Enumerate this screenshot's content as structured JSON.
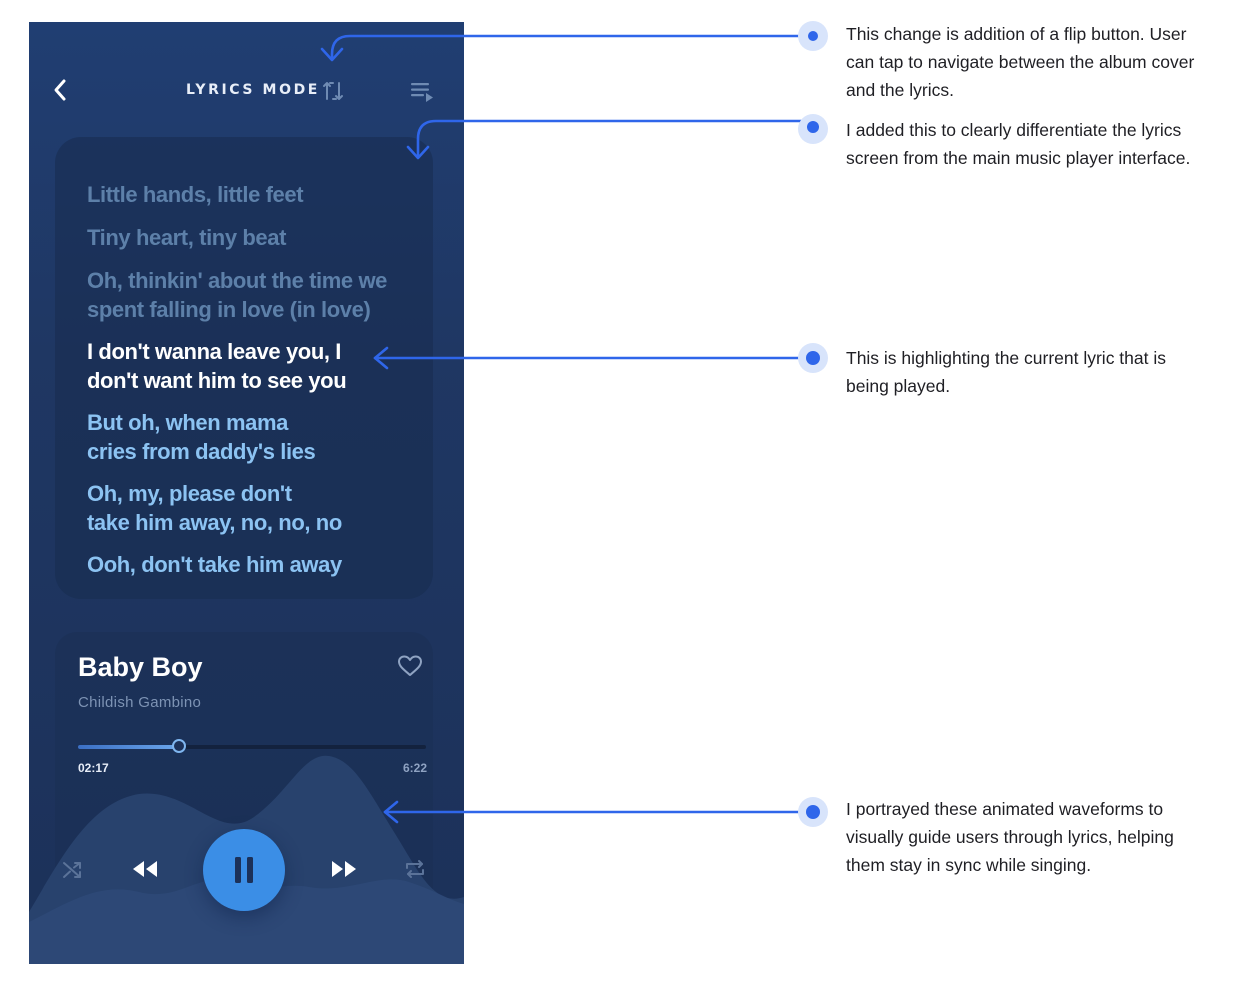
{
  "screen": {
    "header": {
      "back_icon": "chevron-left-icon",
      "title": "LYRICS MODE",
      "flip_icon": "flip-icon",
      "queue_icon": "queue-icon"
    },
    "lyrics": [
      {
        "text": "Little hands, little feet",
        "state": "past"
      },
      {
        "text": "Tiny heart, tiny beat",
        "state": "past"
      },
      {
        "text": "Oh, thinkin' about the time we\nspent falling in love (in love)",
        "state": "past"
      },
      {
        "text": "I don't wanna leave you, I\ndon't want him to see you",
        "state": "current"
      },
      {
        "text": "But oh, when mama\ncries from daddy's lies",
        "state": "upcoming"
      },
      {
        "text": "Oh, my, please don't\ntake him away, no, no, no",
        "state": "upcoming"
      },
      {
        "text": "Ooh, don't take him away",
        "state": "upcoming"
      }
    ],
    "now_playing": {
      "title": "Baby Boy",
      "artist": "Childish Gambino",
      "favorite_icon": "heart-icon",
      "elapsed": "02:17",
      "duration": "6:22",
      "progress_fraction": 0.29
    },
    "controls": {
      "shuffle_icon": "shuffle-icon",
      "previous_icon": "rewind-icon",
      "play_state_icon": "pause-icon",
      "next_icon": "fast-forward-icon",
      "repeat_icon": "repeat-icon"
    },
    "colors": {
      "background": "#1f3763",
      "accent": "#3b8ee6",
      "current_lyric": "#ffffff",
      "upcoming_lyric": "#8cc3f2",
      "past_lyric": "#5d80a9"
    }
  },
  "annotations": [
    {
      "text": "This change is addition of a flip button. User can tap to navigate between the album cover and the lyrics."
    },
    {
      "text": "I added this to clearly differentiate the lyrics screen from the main music player interface."
    },
    {
      "text": "This is highlighting the current lyric that is being played."
    },
    {
      "text": "I portrayed these animated waveforms to visually guide users through lyrics, helping them stay in sync while singing."
    }
  ],
  "annotation_color": "#2f66ea"
}
